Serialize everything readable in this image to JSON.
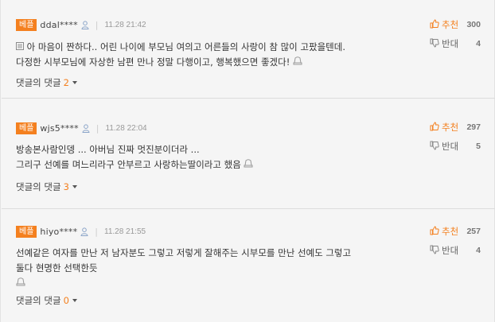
{
  "comments": [
    {
      "badge": "베플",
      "user": "ddal****",
      "date": "11.28 21:42",
      "lines": [
        "아 마음이 짠하다.. 어린 나이에 부모님 여의고 어른들의 사랑이 참 많이 고팠을텐데.",
        "다정한 시부모님에 자상한 남편 만나 정말 다행이고, 행복했으면 좋겠다!"
      ],
      "has_image_icon": true,
      "reply_label": "댓글의 댓글",
      "reply_count": "2",
      "up_label": "추천",
      "up_count": "300",
      "down_label": "반대",
      "down_count": "4"
    },
    {
      "badge": "베플",
      "user": "wjs5****",
      "date": "11.28 22:04",
      "lines": [
        "방송본사람인뎅 ... 아버님 진짜 멋진분이더라 ...",
        "그리구 선예를 며느리라구 안부르고 사랑하는딸이라고 했음"
      ],
      "reply_label": "댓글의 댓글",
      "reply_count": "3",
      "up_label": "추천",
      "up_count": "297",
      "down_label": "반대",
      "down_count": "5"
    },
    {
      "badge": "베플",
      "user": "hiyo****",
      "date": "11.28 21:55",
      "lines": [
        "선예같은 여자를 만난 저 남자분도 그렇고 저렇게 잘해주는 시부모를 만난 선예도 그렇고",
        "둘다 현명한 선택한듯"
      ],
      "reply_label": "댓글의 댓글",
      "reply_count": "0",
      "up_label": "추천",
      "up_count": "257",
      "down_label": "반대",
      "down_count": "4"
    }
  ],
  "colors": {
    "accent": "#f4801f",
    "background": "#f5f5f5",
    "divider": "#dcdcdc"
  },
  "icons": {
    "user": "person-icon",
    "image": "image-icon",
    "report": "report-icon",
    "upvote": "thumbs-up-icon",
    "downvote": "thumbs-down-icon"
  }
}
